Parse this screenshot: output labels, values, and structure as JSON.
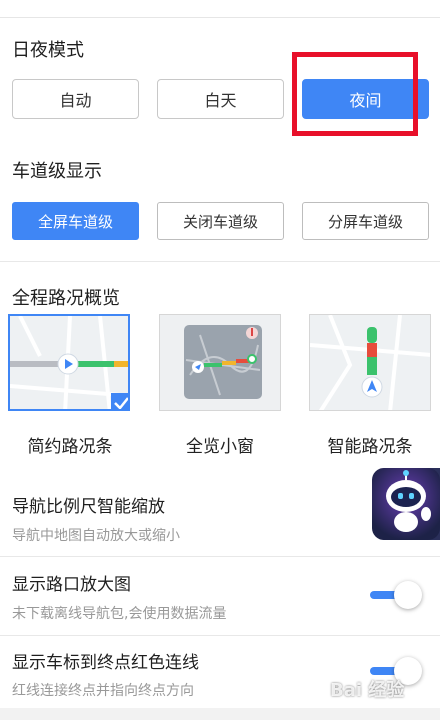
{
  "day_night": {
    "title": "日夜模式",
    "options": [
      "自动",
      "白天",
      "夜间"
    ],
    "selected": "夜间"
  },
  "lane": {
    "title": "车道级显示",
    "options": [
      "全屏车道级",
      "关闭车道级",
      "分屏车道级"
    ],
    "selected": "全屏车道级"
  },
  "overview": {
    "title": "全程路况概览",
    "options": [
      "简约路况条",
      "全览小窗",
      "智能路况条"
    ],
    "selected": "简约路况条"
  },
  "settings": [
    {
      "title": "导航比例尺智能缩放",
      "subtitle": "导航中地图自动放大或缩小"
    },
    {
      "title": "显示路口放大图",
      "subtitle": "未下载离线导航包,会使用数据流量",
      "enabled": true
    },
    {
      "title": "显示车标到终点红色连线",
      "subtitle": "红线连接终点并指向终点方向",
      "enabled": true
    }
  ],
  "colors": {
    "accent": "#3f86f5",
    "highlight": "#e8102a"
  },
  "watermark": "Bai 经验"
}
